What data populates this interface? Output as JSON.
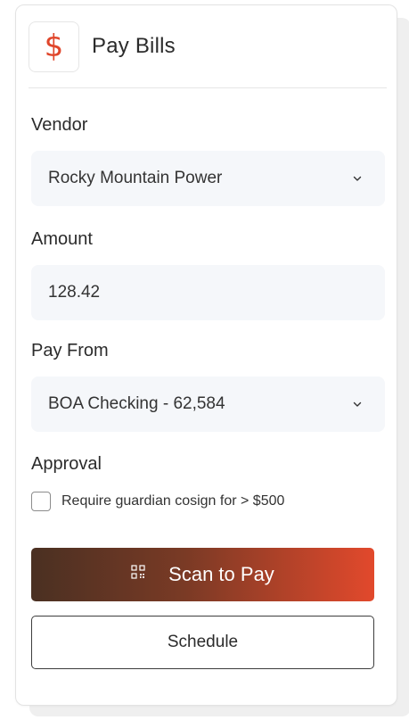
{
  "header": {
    "icon": "dollar-sign-icon",
    "icon_glyph": "$",
    "title": "Pay Bills",
    "accent_color": "#e0462b"
  },
  "form": {
    "vendor": {
      "label": "Vendor",
      "value": "Rocky Mountain Power"
    },
    "amount": {
      "label": "Amount",
      "value": "128.42"
    },
    "pay_from": {
      "label": "Pay From",
      "value": "BOA Checking - 62,584"
    },
    "approval": {
      "label": "Approval",
      "checkbox_label": "Require guardian cosign for > $500",
      "checked": false
    }
  },
  "actions": {
    "primary_label": "Scan to Pay",
    "primary_icon": "qr-code-icon",
    "secondary_label": "Schedule"
  },
  "colors": {
    "gradient_start": "#4a3022",
    "gradient_end": "#e2492c",
    "field_bg": "#f5f7fa"
  }
}
